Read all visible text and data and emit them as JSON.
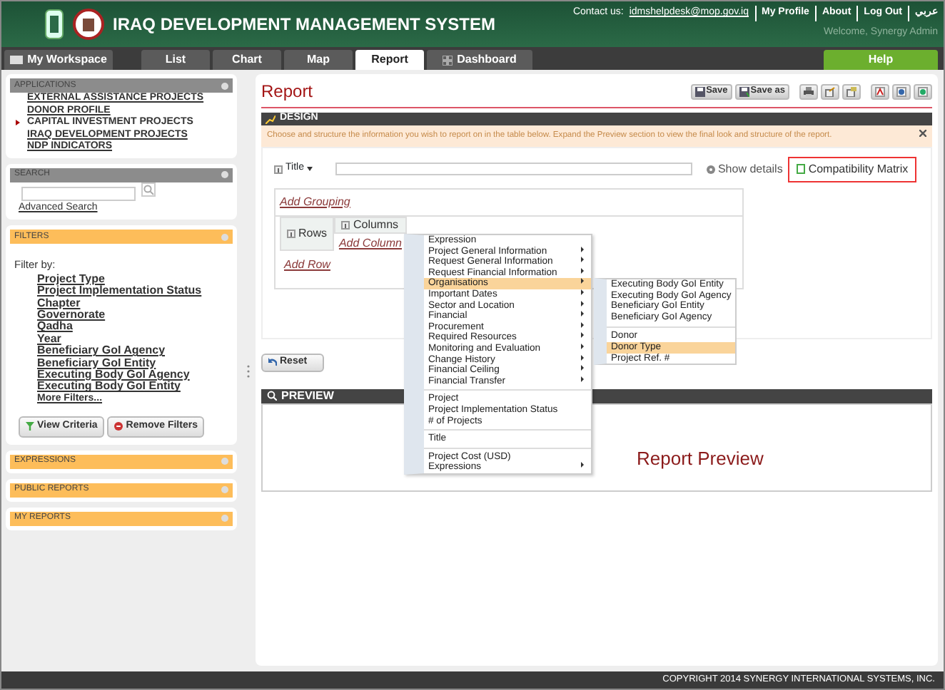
{
  "header": {
    "title": "IRAQ DEVELOPMENT MANAGEMENT SYSTEM",
    "contact_label": "Contact us:",
    "contact_email": "idmshelpdesk@mop.gov.iq",
    "links": [
      "My Profile",
      "About",
      "Log Out",
      "عربي"
    ],
    "welcome": "Welcome,  Synergy Admin"
  },
  "tabs": [
    {
      "label": "My Workspace",
      "kind": "workspace",
      "selected": false
    },
    {
      "label": "List",
      "kind": "plain",
      "selected": false
    },
    {
      "label": "Chart",
      "kind": "plain",
      "selected": false
    },
    {
      "label": "Map",
      "kind": "plain",
      "selected": false
    },
    {
      "label": "Report",
      "kind": "plain",
      "selected": true
    },
    {
      "label": "Dashboard",
      "kind": "dashboard",
      "selected": false
    },
    {
      "label": "Help",
      "kind": "help",
      "selected": false
    }
  ],
  "sidebar": {
    "panels": [
      {
        "title": "APPLICATIONS",
        "kind": "list",
        "items": [
          {
            "label": "EXTERNAL ASSISTANCE PROJECTS",
            "selected": false
          },
          {
            "label": "DONOR PROFILE",
            "selected": false
          },
          {
            "label": "CAPITAL INVESTMENT PROJECTS",
            "selected": true
          },
          {
            "label": "IRAQ DEVELOPMENT PROJECTS",
            "selected": false
          },
          {
            "label": "NDP INDICATORS",
            "selected": false
          }
        ]
      },
      {
        "title": "SEARCH",
        "kind": "search",
        "link": "Advanced Search"
      },
      {
        "title": "FILTERS",
        "kind": "filters",
        "label": "Filter by:",
        "items": [
          "Project Type",
          "Project Implementation Status",
          "Chapter",
          "Governorate",
          "Qadha",
          "Year",
          "Beneficiary GoI Agency",
          "Beneficiary GoI Entity",
          "Executing Body GoI Agency",
          "Executing Body GoI Entity",
          "More Filters..."
        ],
        "buttons": [
          "View Criteria",
          "Remove Filters"
        ]
      },
      {
        "title": "EXPRESSIONS",
        "kind": "collapsed"
      },
      {
        "title": "PUBLIC REPORTS",
        "kind": "collapsed"
      },
      {
        "title": "MY REPORTS",
        "kind": "collapsed"
      }
    ]
  },
  "report": {
    "title": "Report",
    "toolbar": [
      {
        "kind": "save",
        "label": "Save"
      },
      {
        "kind": "saveas",
        "label": "Save as"
      },
      {
        "kind": "print"
      },
      {
        "kind": "export"
      },
      {
        "kind": "import"
      },
      {
        "kind": "pdf"
      },
      {
        "kind": "word"
      },
      {
        "kind": "excel"
      }
    ],
    "design": {
      "title": "DESIGN",
      "notice": "Choose and structure the information you wish to report on in the table below. Expand the Preview section to view the final look and structure of the report.",
      "title_label": "Title",
      "show_details": "Show details",
      "compat_matrix": "Compatibility Matrix",
      "add_grouping": "Add Grouping",
      "rows": "Rows",
      "columns": "Columns",
      "add_column": "Add Column",
      "add_row": "Add Row"
    },
    "reset": "Reset",
    "preview": {
      "title": "PREVIEW",
      "text": "Report Preview"
    }
  },
  "context_menu": {
    "groups": [
      [
        {
          "label": "Expression",
          "submenu": false,
          "selected": false
        },
        {
          "label": "Project General Information",
          "submenu": true,
          "selected": false
        },
        {
          "label": "Request General Information",
          "submenu": true,
          "selected": false
        },
        {
          "label": "Request Financial Information",
          "submenu": true,
          "selected": false
        },
        {
          "label": "Organisations",
          "submenu": true,
          "selected": true
        },
        {
          "label": "Important Dates",
          "submenu": true,
          "selected": false
        },
        {
          "label": "Sector and Location",
          "submenu": true,
          "selected": false
        },
        {
          "label": "Financial",
          "submenu": true,
          "selected": false
        },
        {
          "label": "Procurement",
          "submenu": true,
          "selected": false
        },
        {
          "label": "Required Resources",
          "submenu": true,
          "selected": false
        },
        {
          "label": "Monitoring and Evaluation",
          "submenu": true,
          "selected": false
        },
        {
          "label": "Change History",
          "submenu": true,
          "selected": false
        },
        {
          "label": "Financial Ceiling",
          "submenu": true,
          "selected": false
        },
        {
          "label": "Financial Transfer",
          "submenu": true,
          "selected": false
        }
      ],
      [
        {
          "label": "Project",
          "submenu": false,
          "selected": false
        },
        {
          "label": "Project Implementation Status",
          "submenu": false,
          "selected": false
        },
        {
          "label": "# of Projects",
          "submenu": false,
          "selected": false
        }
      ],
      [
        {
          "label": "Title",
          "submenu": false,
          "selected": false
        }
      ],
      [
        {
          "label": "Project Cost (USD)",
          "submenu": false,
          "selected": false
        },
        {
          "label": "Expressions",
          "submenu": true,
          "selected": false
        }
      ]
    ],
    "submenu": [
      [
        {
          "label": "Executing Body GoI Entity",
          "selected": false
        },
        {
          "label": "Executing Body GoI Agency",
          "selected": false
        },
        {
          "label": "Beneficiary GoI Entity",
          "selected": false
        },
        {
          "label": "Beneficiary GoI Agency",
          "selected": false
        }
      ],
      [
        {
          "label": "Donor",
          "selected": false
        },
        {
          "label": "Donor Type",
          "selected": true
        },
        {
          "label": "Project Ref. #",
          "selected": false
        }
      ]
    ]
  },
  "footer": "COPYRIGHT 2014 SYNERGY INTERNATIONAL SYSTEMS, INC."
}
